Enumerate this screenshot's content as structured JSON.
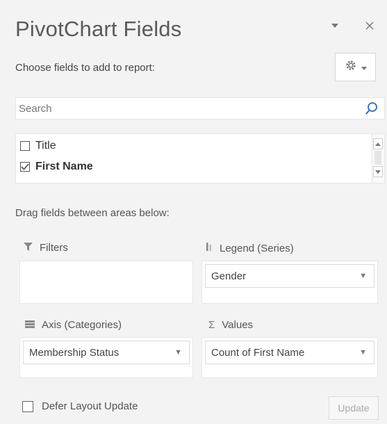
{
  "pane": {
    "title": "PivotChart Fields",
    "choose_label": "Choose fields to add to report:",
    "search": {
      "value": "",
      "placeholder": "Search"
    },
    "fields": [
      {
        "label": "Title",
        "checked": false
      },
      {
        "label": "First Name",
        "checked": true
      }
    ],
    "drag_label": "Drag fields between areas below:",
    "areas": {
      "filters": {
        "label": "Filters",
        "value": ""
      },
      "legend": {
        "label": "Legend (Series)",
        "value": "Gender"
      },
      "axis": {
        "label": "Axis (Categories)",
        "value": "Membership Status"
      },
      "values": {
        "label": "Values",
        "value": "Count of First Name",
        "icon_glyph": "Σ"
      }
    },
    "defer_label": "Defer Layout Update",
    "update_label": "Update"
  },
  "icons": {
    "options": "chevron-down-icon",
    "close": "close-icon",
    "settings": "gear-icon",
    "search": "search-icon",
    "filters": "filter-icon",
    "legend": "legend-icon",
    "axis": "axis-icon"
  },
  "colors": {
    "accent": "#2b6fb5",
    "background": "#f3f3f3"
  }
}
